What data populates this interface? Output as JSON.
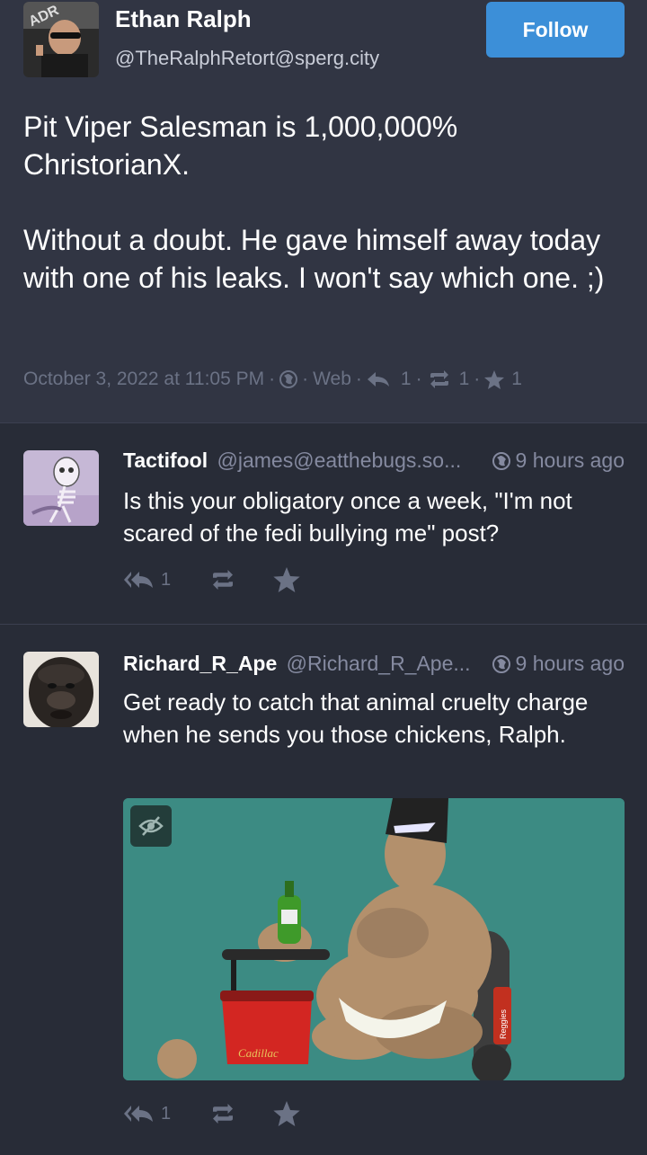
{
  "main_post": {
    "author": {
      "display_name": "Ethan Ralph",
      "handle": "@TheRalphRetort@sperg.city",
      "avatar_text": "ADR"
    },
    "follow_label": "Follow",
    "paragraphs": [
      "Pit Viper Salesman is 1,000,000% ChristorianX.",
      "Without a doubt. He gave himself away today with one of his leaks. I won't say which one. ;)"
    ],
    "meta": {
      "timestamp": "October 3, 2022 at 11:05 PM",
      "separator": "·",
      "visibility_icon": "globe-icon",
      "client": "Web",
      "reply_count": "1",
      "boost_count": "1",
      "favourite_count": "1"
    }
  },
  "replies": [
    {
      "display_name": "Tactifool",
      "handle": "@james@eatthebugs.so...",
      "time": "9 hours ago",
      "text": "Is this your obligatory once a week, \"I'm not scared of the fedi bullying me\" post?",
      "reply_count": "1"
    },
    {
      "display_name": "Richard_R_Ape",
      "handle": "@Richard_R_Ape...",
      "time": "9 hours ago",
      "text": "Get ready to catch that animal cruelty charge when he sends you those chickens, Ralph.",
      "reply_count": "1",
      "media": {
        "hide_icon": "eye-slash-icon",
        "logo_text": "Cadillac",
        "can_text": "Reggies"
      }
    }
  ],
  "colors": {
    "background": "#282c37",
    "main_post_background": "#313543",
    "accent": "#3c8fd8",
    "muted_text": "#6b7285"
  }
}
